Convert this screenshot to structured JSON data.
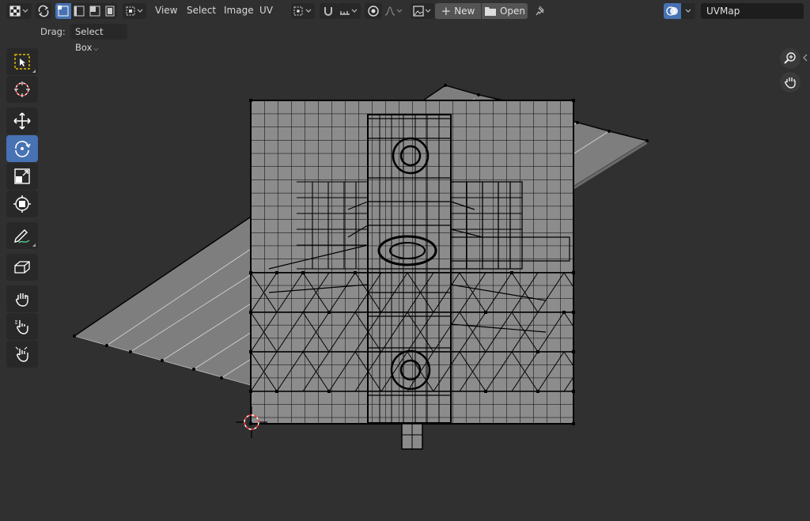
{
  "header": {
    "menus": [
      "View",
      "Select",
      "Image",
      "UV"
    ],
    "new_label": "New",
    "open_label": "Open",
    "uv_map_value": "UVMap"
  },
  "tool_settings": {
    "drag_label": "Drag:",
    "drag_value": "Select Box"
  },
  "toolbar": {
    "tools": [
      "select-box",
      "cursor",
      "move",
      "rotate",
      "scale",
      "transform",
      "annotate",
      "rip-region",
      "grab",
      "relax",
      "pinch"
    ],
    "active_tool": "rotate"
  },
  "colors": {
    "background": "#303030",
    "header": "#303030",
    "button": "#282828",
    "active_blue": "#4772b3",
    "image_fill": "#8a8a8a",
    "mesh_fill": "#9a9a9a",
    "wire": "#000000",
    "cursor_red": "#ff3030"
  }
}
